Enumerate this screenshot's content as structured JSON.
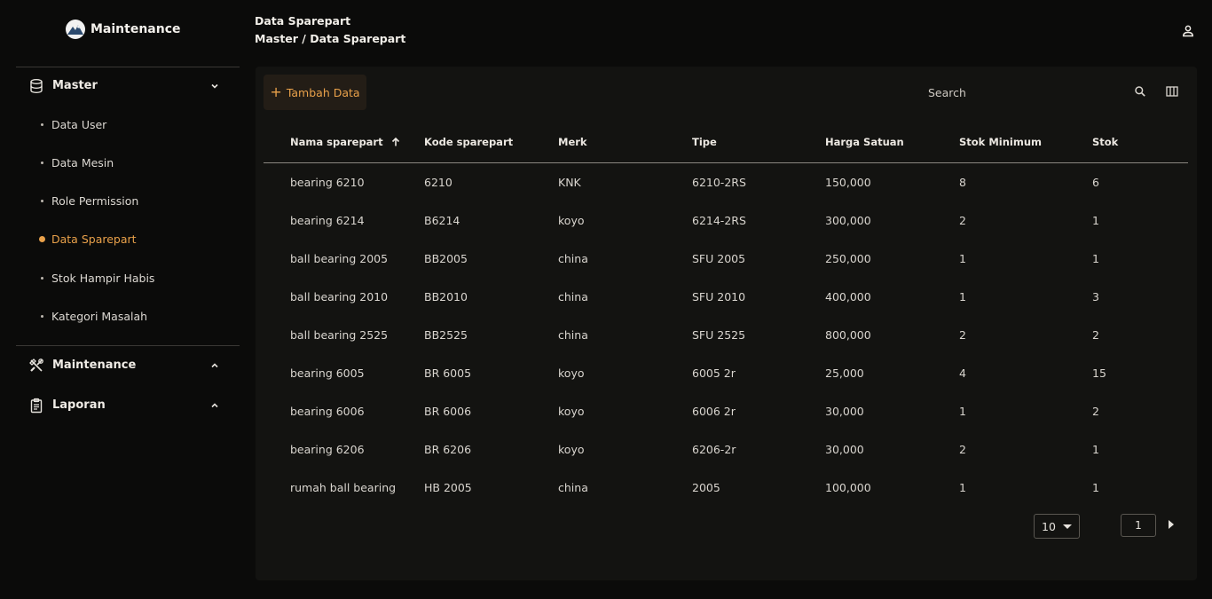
{
  "brand": {
    "name": "Maintenance"
  },
  "header": {
    "title": "Data Sparepart",
    "breadcrumb": "Master / Data Sparepart"
  },
  "sidebar": {
    "groups": [
      {
        "label": "Master",
        "icon": "database-icon",
        "expanded": true
      },
      {
        "label": "Maintenance",
        "icon": "tools-icon",
        "expanded": false
      },
      {
        "label": "Laporan",
        "icon": "clipboard-icon",
        "expanded": false
      }
    ],
    "items": [
      {
        "label": "Data User"
      },
      {
        "label": "Data Mesin"
      },
      {
        "label": "Role Permission"
      },
      {
        "label": "Data Sparepart",
        "active": true
      },
      {
        "label": "Stok Hampir Habis"
      },
      {
        "label": "Kategori Masalah"
      }
    ]
  },
  "toolbar": {
    "add_label": "Tambah Data",
    "search_placeholder": "Search"
  },
  "table": {
    "columns": [
      "Nama sparepart",
      "Kode sparepart",
      "Merk",
      "Tipe",
      "Harga Satuan",
      "Stok Minimum",
      "Stok"
    ],
    "sorted_column": "Nama sparepart",
    "sort_direction": "asc",
    "rows": [
      [
        "bearing 6210",
        "6210",
        "KNK",
        "6210-2RS",
        "150,000",
        "8",
        "6"
      ],
      [
        "bearing 6214",
        "B6214",
        "koyo",
        "6214-2RS",
        "300,000",
        "2",
        "1"
      ],
      [
        "ball bearing 2005",
        "BB2005",
        "china",
        "SFU 2005",
        "250,000",
        "1",
        "1"
      ],
      [
        "ball bearing 2010",
        "BB2010",
        "china",
        "SFU 2010",
        "400,000",
        "1",
        "3"
      ],
      [
        "ball bearing 2525",
        "BB2525",
        "china",
        "SFU 2525",
        "800,000",
        "2",
        "2"
      ],
      [
        "bearing 6005",
        "BR 6005",
        "koyo",
        "6005 2r",
        "25,000",
        "4",
        "15"
      ],
      [
        "bearing 6006",
        "BR 6006",
        "koyo",
        "6006 2r",
        "30,000",
        "1",
        "2"
      ],
      [
        "bearing 6206",
        "BR 6206",
        "koyo",
        "6206-2r",
        "30,000",
        "2",
        "1"
      ],
      [
        "rumah ball bearing",
        "HB 2005",
        "china",
        "2005",
        "100,000",
        "1",
        "1"
      ]
    ]
  },
  "pagination": {
    "rows_per_page": "10",
    "page": "1"
  },
  "colors": {
    "accent": "#e9a14a",
    "background": "#0b0b0a",
    "panel": "#131311"
  }
}
